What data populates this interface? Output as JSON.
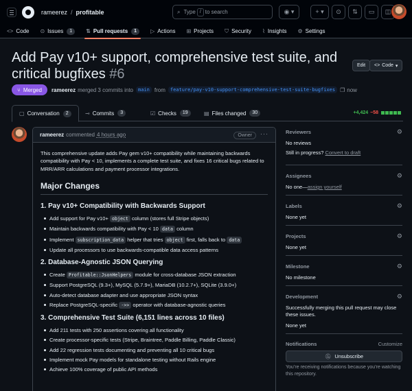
{
  "header": {
    "owner": "rameerez",
    "repo": "profitable",
    "search_prefix": "Type",
    "search_key": "/",
    "search_suffix": "to search"
  },
  "repo_nav": [
    {
      "label": "Code",
      "icon": "code-icon"
    },
    {
      "label": "Issues",
      "count": "1",
      "icon": "issue-icon"
    },
    {
      "label": "Pull requests",
      "count": "1",
      "icon": "pr-icon",
      "active": true
    },
    {
      "label": "Actions",
      "icon": "play-icon"
    },
    {
      "label": "Projects",
      "icon": "table-icon"
    },
    {
      "label": "Security",
      "icon": "shield-icon"
    },
    {
      "label": "Insights",
      "icon": "graph-icon"
    },
    {
      "label": "Settings",
      "icon": "gear-icon"
    }
  ],
  "pr": {
    "title": "Add Pay v10+ support, comprehensive test suite, and critical bugfixes",
    "number": "#6",
    "edit_label": "Edit",
    "code_label": "Code",
    "status": "Merged",
    "author": "rameerez",
    "merged_text": "merged 3 commits into",
    "base": "main",
    "from_text": "from",
    "head": "feature/pay-v10-support-comprehensive-test-suite-bugfixes",
    "time": "now"
  },
  "pr_tabs": [
    {
      "label": "Conversation",
      "count": "2"
    },
    {
      "label": "Commits",
      "count": "3"
    },
    {
      "label": "Checks",
      "count": "19"
    },
    {
      "label": "Files changed",
      "count": "30"
    }
  ],
  "diffstat": {
    "additions": "+4,424",
    "deletions": "−58"
  },
  "comment": {
    "author": "rameerez",
    "action": "commented",
    "when": "4 hours ago",
    "role": "Owner",
    "intro": "This comprehensive update adds Pay gem v10+ compatibility while maintaining backwards compatibility with Pay < 10, implements a complete test suite, and fixes 16 critical bugs related to MRR/ARR calculations and payment processor integrations.",
    "major_heading": "Major Changes",
    "s1_heading": "1. Pay v10+ Compatibility with Backwards Support",
    "s1_i1a": "Add support for Pay v10+",
    "s1_i1code": "object",
    "s1_i1b": "column (stores full Stripe objects)",
    "s1_i2a": "Maintain backwards compatibility with Pay < 10",
    "s1_i2code": "data",
    "s1_i2b": "column",
    "s1_i3a": "Implement",
    "s1_i3code1": "subscription_data",
    "s1_i3b": "helper that tries",
    "s1_i3code2": "object",
    "s1_i3c": "first, falls back to",
    "s1_i3code3": "data",
    "s1_i4": "Update all processors to use backwards-compatible data access patterns",
    "s2_heading": "2. Database-Agnostic JSON Querying",
    "s2_i1a": "Create",
    "s2_i1code": "Profitable::JsonHelpers",
    "s2_i1b": "module for cross-database JSON extraction",
    "s2_i2": "Support PostgreSQL (9.3+), MySQL (5.7.9+), MariaDB (10.2.7+), SQLite (3.9.0+)",
    "s2_i3": "Auto-detect database adapter and use appropriate JSON syntax",
    "s2_i4a": "Replace PostgreSQL-specific",
    "s2_i4code": "->>",
    "s2_i4b": "operator with database-agnostic queries",
    "s3_heading": "3. Comprehensive Test Suite (6,151 lines across 10 files)",
    "s3_items": [
      "Add 211 tests with 250 assertions covering all functionality",
      "Create processor-specific tests (Stripe, Braintree, Paddle Billing, Paddle Classic)",
      "Add 22 regression tests documenting and preventing all 10 critical bugs",
      "Implement mock Pay models for standalone testing without Rails engine",
      "Achieve 100% coverage of public API methods"
    ]
  },
  "sidebar": {
    "reviewers_title": "Reviewers",
    "reviewers_value": "No reviews",
    "in_progress": "Still in progress?",
    "convert_draft": "Convert to draft",
    "assignees_title": "Assignees",
    "assignees_none": "No one—",
    "assign_yourself": "assign yourself",
    "labels_title": "Labels",
    "labels_value": "None yet",
    "projects_title": "Projects",
    "projects_value": "None yet",
    "milestone_title": "Milestone",
    "milestone_value": "No milestone",
    "development_title": "Development",
    "development_note": "Successfully merging this pull request may close these issues.",
    "development_value": "None yet",
    "notifications_title": "Notifications",
    "customize": "Customize",
    "unsubscribe": "Unsubscribe",
    "notif_note": "You’re receiving notifications because you’re watching this repository."
  }
}
